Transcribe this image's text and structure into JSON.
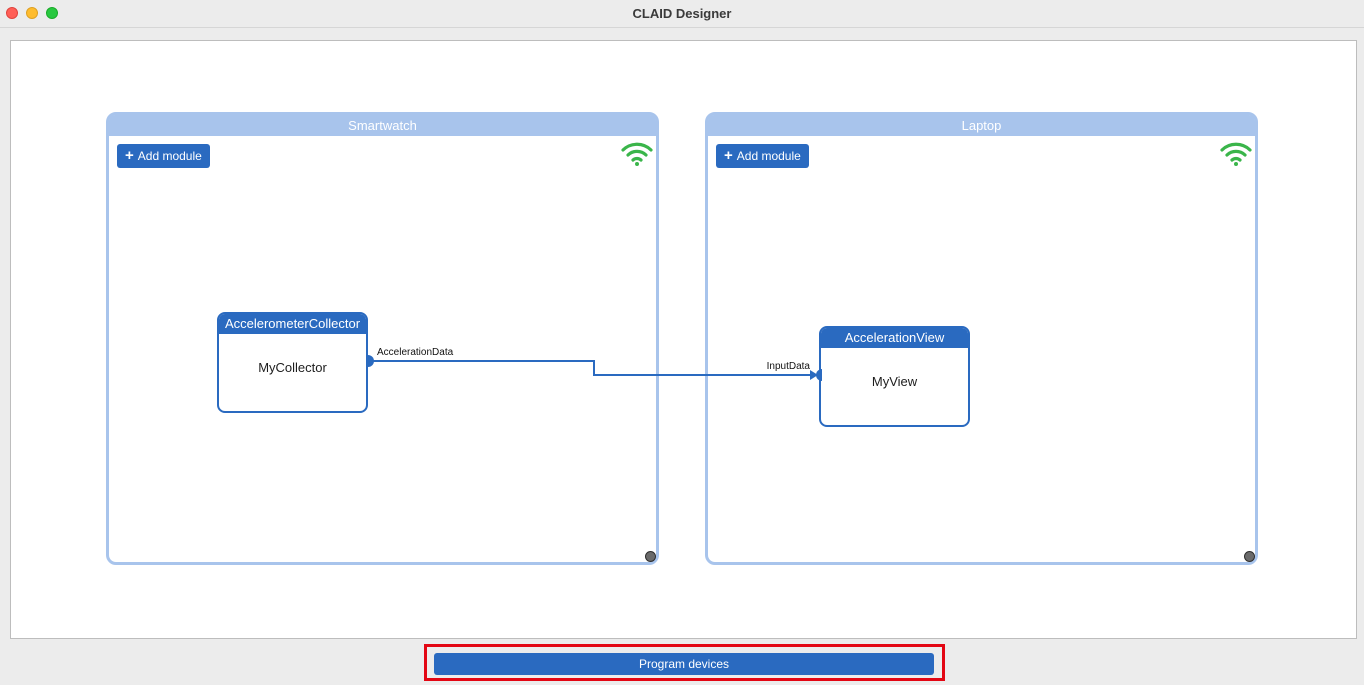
{
  "window": {
    "title": "CLAID Designer"
  },
  "devices": [
    {
      "name": "Smartwatch",
      "add_module_label": "Add module",
      "status_icon": "wifi-icon",
      "modules": [
        {
          "type": "AccelerometerCollector",
          "name": "MyCollector",
          "output_port": "AccelerationData"
        }
      ]
    },
    {
      "name": "Laptop",
      "add_module_label": "Add module",
      "status_icon": "wifi-icon",
      "modules": [
        {
          "type": "AccelerationView",
          "name": "MyView",
          "input_port": "InputData"
        }
      ]
    }
  ],
  "footer": {
    "program_label": "Program devices"
  },
  "colors": {
    "accent": "#2a6ac0",
    "device_border": "#a8c4ec",
    "wifi": "#3ab54a",
    "highlight": "#e30613"
  }
}
